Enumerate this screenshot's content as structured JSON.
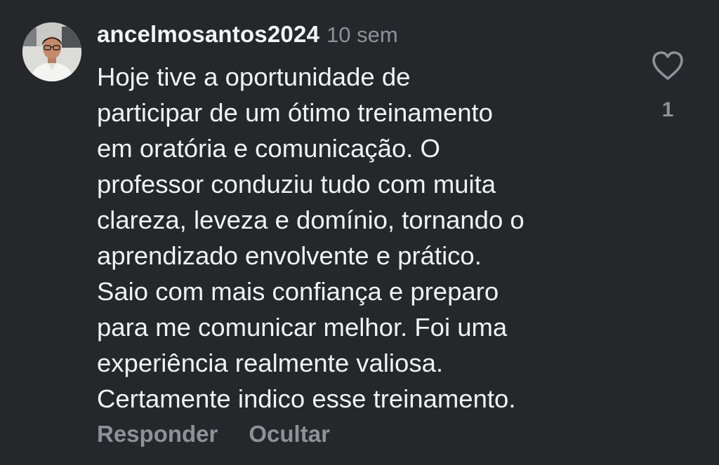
{
  "comment": {
    "author": "ancelmosantos2024",
    "time_ago": "10 sem",
    "lines": [
      "Hoje tive a oportunidade de",
      "participar de um ótimo treinamento",
      "em oratória e comunicação. O",
      "professor conduziu tudo com muita",
      "clareza, leveza e domínio, tornando o",
      "aprendizado envolvente e prático.",
      "Saio com mais confiança e preparo",
      "para me comunicar melhor. Foi uma",
      "experiência realmente valiosa.",
      "Certamente indico esse treinamento."
    ],
    "like_icon": "heart-outline-icon",
    "like_count": "1",
    "actions": {
      "reply_label": "Responder",
      "hide_label": "Ocultar"
    }
  },
  "colors": {
    "background": "#25272b",
    "text_primary": "#f2f2f2",
    "text_secondary": "#8d9198"
  }
}
